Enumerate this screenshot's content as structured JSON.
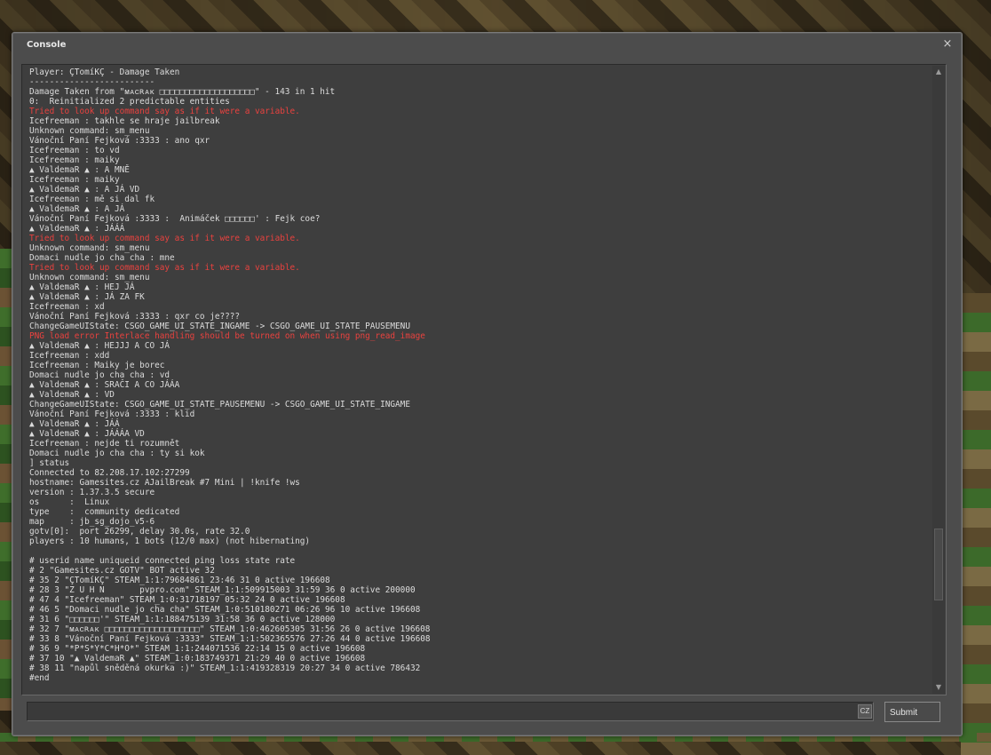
{
  "window": {
    "title": "Console",
    "close_glyph": "×",
    "close_icon": "close-icon"
  },
  "console": {
    "lines": [
      {
        "text": "Player: ÇTomíKÇ - Damage Taken",
        "error": false
      },
      {
        "text": "-------------------------",
        "error": false
      },
      {
        "text": "Damage Taken from \"ᴍᴀᴄʀᴀᴋ □□□□□□□□□□□□□□□□□□□\" - 143 in 1 hit",
        "error": false
      },
      {
        "text": "0:  Reinitialized 2 predictable entities",
        "error": false
      },
      {
        "text": "Tried to look up command say as if it were a variable.",
        "error": true
      },
      {
        "text": "Icefreeman : takhle se hraje jailbreak",
        "error": false
      },
      {
        "text": "Unknown command: sm_menu",
        "error": false
      },
      {
        "text": "Vánoční Paní Fejková :3333 : ano qxr",
        "error": false
      },
      {
        "text": "Icefreeman : to vd",
        "error": false
      },
      {
        "text": "Icefreeman : maiky",
        "error": false
      },
      {
        "text": "▲ ValdemaR ▲ : A MNĚ",
        "error": false
      },
      {
        "text": "Icefreeman : maiky",
        "error": false
      },
      {
        "text": "▲ ValdemaR ▲ : A JÁ VD",
        "error": false
      },
      {
        "text": "Icefreeman : mě si dal fk",
        "error": false
      },
      {
        "text": "▲ ValdemaR ▲ : A JÁ",
        "error": false
      },
      {
        "text": "Vánoční Paní Fejková :3333 :  Animáček □□□□□□' : Fejk coe?",
        "error": false
      },
      {
        "text": "▲ ValdemaR ▲ : JÁÁÁ",
        "error": false
      },
      {
        "text": "Tried to look up command say as if it were a variable.",
        "error": true
      },
      {
        "text": "Unknown command: sm_menu",
        "error": false
      },
      {
        "text": "Domaci nudle jo cha cha : mne",
        "error": false
      },
      {
        "text": "Tried to look up command say as if it were a variable.",
        "error": true
      },
      {
        "text": "Unknown command: sm_menu",
        "error": false
      },
      {
        "text": "▲ ValdemaR ▲ : HEJ JÁ",
        "error": false
      },
      {
        "text": "▲ ValdemaR ▲ : JÁ ZA FK",
        "error": false
      },
      {
        "text": "Icefreeman : xd",
        "error": false
      },
      {
        "text": "Vánoční Paní Fejková :3333 : qxr co je????",
        "error": false
      },
      {
        "text": "ChangeGameUIState: CSGO_GAME_UI_STATE_INGAME -> CSGO_GAME_UI_STATE_PAUSEMENU",
        "error": false
      },
      {
        "text": "PNG load error Interlace handling should be turned on when using png_read_image",
        "error": true
      },
      {
        "text": "▲ ValdemaR ▲ : HEJJJ A CO JÁ",
        "error": false
      },
      {
        "text": "Icefreeman : xdd",
        "error": false
      },
      {
        "text": "Icefreeman : Maiky je borec",
        "error": false
      },
      {
        "text": "Domaci nudle jo cha cha : vd",
        "error": false
      },
      {
        "text": "▲ ValdemaR ▲ : SRAČI A CO JÁÁA",
        "error": false
      },
      {
        "text": "▲ ValdemaR ▲ : VD",
        "error": false
      },
      {
        "text": "ChangeGameUIState: CSGO_GAME_UI_STATE_PAUSEMENU -> CSGO_GAME_UI_STATE_INGAME",
        "error": false
      },
      {
        "text": "Vánoční Paní Fejková :3333 : klid",
        "error": false
      },
      {
        "text": "▲ ValdemaR ▲ : JÁÁ",
        "error": false
      },
      {
        "text": "▲ ValdemaR ▲ : JÁÁÁA VD",
        "error": false
      },
      {
        "text": "Icefreeman : nejde ti rozumnět",
        "error": false
      },
      {
        "text": "Domaci nudle jo cha cha : ty si kok",
        "error": false
      },
      {
        "text": "] status",
        "error": false
      },
      {
        "text": "Connected to 82.208.17.102:27299",
        "error": false
      },
      {
        "text": "hostname: Gamesites.cz AJailBreak #7 Mini | !knife !ws",
        "error": false
      },
      {
        "text": "version : 1.37.3.5 secure",
        "error": false
      },
      {
        "text": "os      :  Linux",
        "error": false
      },
      {
        "text": "type    :  community dedicated",
        "error": false
      },
      {
        "text": "map     : jb_sg_dojo_v5-6",
        "error": false
      },
      {
        "text": "gotv[0]:  port 26299, delay 30.0s, rate 32.0",
        "error": false
      },
      {
        "text": "players : 10 humans, 1 bots (12/0 max) (not hibernating)",
        "error": false
      },
      {
        "text": "",
        "error": false
      },
      {
        "text": "# userid name uniqueid connected ping loss state rate",
        "error": false
      },
      {
        "text": "# 2 \"Gamesites.cz GOTV\" BOT active 32",
        "error": false
      },
      {
        "text": "# 35 2 \"ÇTomíKÇ\" STEAM_1:1:79684861 23:46 31 0 active 196608",
        "error": false
      },
      {
        "text": "# 28 3 \"Z U H N       pvpro.com\" STEAM_1:1:509915003 31:59 36 0 active 200000",
        "error": false
      },
      {
        "text": "# 47 4 \"Icefreeman\" STEAM_1:0:31718197 05:32 24 0 active 196608",
        "error": false
      },
      {
        "text": "# 46 5 \"Domaci nudle jo cha cha\" STEAM_1:0:510180271 06:26 96 10 active 196608",
        "error": false
      },
      {
        "text": "# 31 6 \"□□□□□□'\" STEAM_1:1:188475139 31:58 36 0 active 128000",
        "error": false
      },
      {
        "text": "# 32 7 \"ᴍᴀᴄʀᴀᴋ □□□□□□□□□□□□□□□□□□□\" STEAM_1:0:462605305 31:56 26 0 active 196608",
        "error": false
      },
      {
        "text": "# 33 8 \"Vánoční Paní Fejková :3333\" STEAM_1:1:502365576 27:26 44 0 active 196608",
        "error": false
      },
      {
        "text": "# 36 9 \"*P*S*Y*C*H*O*\" STEAM_1:1:244071536 22:14 15 0 active 196608",
        "error": false
      },
      {
        "text": "# 37 10 \"▲ ValdemaR ▲\" STEAM_1:0:183749371 21:29 40 0 active 196608",
        "error": false
      },
      {
        "text": "# 38 11 \"napůl sněděná okurka :)\" STEAM_1:1:419328319 20:27 34 0 active 786432",
        "error": false
      },
      {
        "text": "#end",
        "error": false
      }
    ],
    "scroll": {
      "position": 0.85,
      "visible_fraction": 0.12
    },
    "error_color": "#e9423f",
    "text_color": "#dcdcdc"
  },
  "input": {
    "value": "",
    "placeholder": "",
    "language_badge": "CZ"
  },
  "submit": {
    "label": "Submit"
  },
  "scrollbar": {
    "up_glyph": "▲",
    "down_glyph": "▼"
  }
}
